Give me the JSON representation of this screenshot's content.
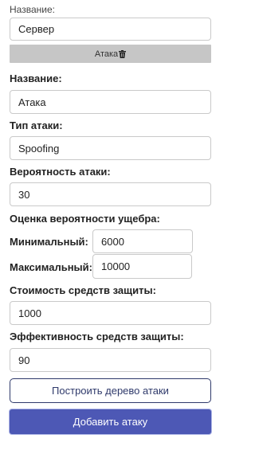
{
  "top": {
    "name_label": "Название:",
    "name_value": "Сервер"
  },
  "attack_bar": {
    "label": "Атака",
    "icon": "trash-icon"
  },
  "attack": {
    "name_label": "Название:",
    "name_value": "Атака",
    "type_label": "Тип атаки:",
    "type_value": "Spoofing",
    "probability_label": "Вероятность атаки:",
    "probability_value": "30",
    "damage_label": "Оценка вероятности ущебра:",
    "min_label": "Минимальный:",
    "min_value": "6000",
    "max_label": "Максимальный:",
    "max_value": "10000",
    "cost_label": "Стоимость средств защиты:",
    "cost_value": "1000",
    "efficiency_label": "Эффективность средств защиты:",
    "efficiency_value": "90"
  },
  "buttons": {
    "build_tree": "Построить дерево атаки",
    "add_attack": "Добавить атаку"
  },
  "colors": {
    "primary": "#4d58b5",
    "outline": "#2f3a6b",
    "attack_bar_bg": "#c6c6c6"
  }
}
